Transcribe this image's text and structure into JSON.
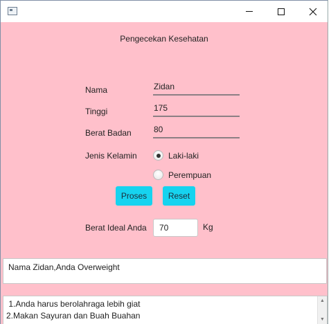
{
  "window": {
    "icon": "window-app-icon",
    "controls": [
      "minimize-icon",
      "maximize-icon",
      "close-icon"
    ]
  },
  "form": {
    "title": "Pengecekan Kesehatan",
    "nama_label": "Nama",
    "nama_value": "Zidan",
    "tinggi_label": "Tinggi",
    "tinggi_value": "175",
    "berat_label": "Berat Badan",
    "berat_value": "80",
    "gender_label": "Jenis Kelamin",
    "gender_options": [
      {
        "label": "Laki-laki",
        "selected": true
      },
      {
        "label": "Perempuan",
        "selected": false
      }
    ]
  },
  "buttons": {
    "proses": "Proses",
    "reset": "Reset",
    "color": "#16d3ef"
  },
  "ideal": {
    "label": "Berat Ideal Anda",
    "value": "70",
    "unit": "Kg"
  },
  "result": {
    "text": "Nama Zidan,Anda Overweight"
  },
  "advice": {
    "lines": [
      " 1.Anda harus berolahraga lebih giat",
      "2.Makan Sayuran dan Buah Buahan"
    ]
  },
  "colors": {
    "background": "#ffc0cb",
    "button": "#16d3ef"
  }
}
